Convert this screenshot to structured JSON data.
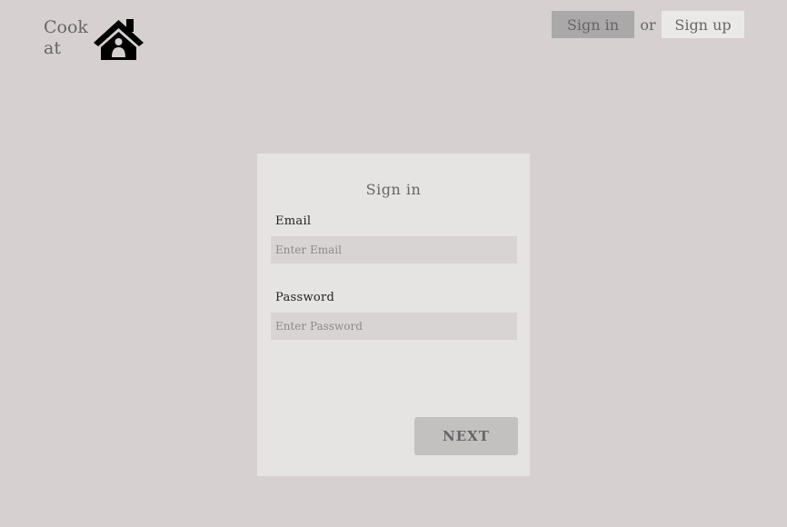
{
  "brand": {
    "line1": "Cook",
    "line2": "at",
    "icon": "house-icon"
  },
  "nav": {
    "sign_in_label": "Sign in",
    "or_text": "or",
    "sign_up_label": "Sign up"
  },
  "form": {
    "title": "Sign in",
    "email_label": "Email",
    "email_placeholder": "Enter Email",
    "email_value": "",
    "password_label": "Password",
    "password_placeholder": "Enter Password",
    "password_value": "",
    "next_label": "NEXT"
  },
  "colors": {
    "background": "#d6d0d0",
    "card": "#e6e3e3",
    "input": "#d8d4d4",
    "sign_in_button": "#aaa8a8",
    "sign_up_button": "#ebe8e8",
    "next_button": "#c3c0c0"
  }
}
